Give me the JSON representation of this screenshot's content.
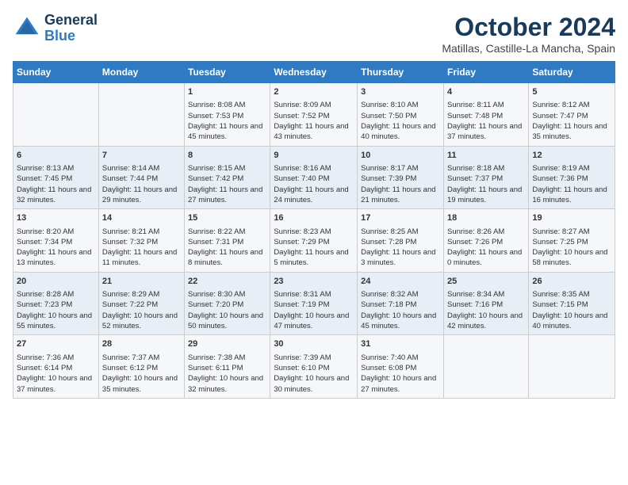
{
  "logo": {
    "line1": "General",
    "line2": "Blue"
  },
  "title": "October 2024",
  "location": "Matillas, Castille-La Mancha, Spain",
  "days_of_week": [
    "Sunday",
    "Monday",
    "Tuesday",
    "Wednesday",
    "Thursday",
    "Friday",
    "Saturday"
  ],
  "weeks": [
    [
      {
        "day": "",
        "content": ""
      },
      {
        "day": "",
        "content": ""
      },
      {
        "day": "1",
        "content": "Sunrise: 8:08 AM\nSunset: 7:53 PM\nDaylight: 11 hours and 45 minutes."
      },
      {
        "day": "2",
        "content": "Sunrise: 8:09 AM\nSunset: 7:52 PM\nDaylight: 11 hours and 43 minutes."
      },
      {
        "day": "3",
        "content": "Sunrise: 8:10 AM\nSunset: 7:50 PM\nDaylight: 11 hours and 40 minutes."
      },
      {
        "day": "4",
        "content": "Sunrise: 8:11 AM\nSunset: 7:48 PM\nDaylight: 11 hours and 37 minutes."
      },
      {
        "day": "5",
        "content": "Sunrise: 8:12 AM\nSunset: 7:47 PM\nDaylight: 11 hours and 35 minutes."
      }
    ],
    [
      {
        "day": "6",
        "content": "Sunrise: 8:13 AM\nSunset: 7:45 PM\nDaylight: 11 hours and 32 minutes."
      },
      {
        "day": "7",
        "content": "Sunrise: 8:14 AM\nSunset: 7:44 PM\nDaylight: 11 hours and 29 minutes."
      },
      {
        "day": "8",
        "content": "Sunrise: 8:15 AM\nSunset: 7:42 PM\nDaylight: 11 hours and 27 minutes."
      },
      {
        "day": "9",
        "content": "Sunrise: 8:16 AM\nSunset: 7:40 PM\nDaylight: 11 hours and 24 minutes."
      },
      {
        "day": "10",
        "content": "Sunrise: 8:17 AM\nSunset: 7:39 PM\nDaylight: 11 hours and 21 minutes."
      },
      {
        "day": "11",
        "content": "Sunrise: 8:18 AM\nSunset: 7:37 PM\nDaylight: 11 hours and 19 minutes."
      },
      {
        "day": "12",
        "content": "Sunrise: 8:19 AM\nSunset: 7:36 PM\nDaylight: 11 hours and 16 minutes."
      }
    ],
    [
      {
        "day": "13",
        "content": "Sunrise: 8:20 AM\nSunset: 7:34 PM\nDaylight: 11 hours and 13 minutes."
      },
      {
        "day": "14",
        "content": "Sunrise: 8:21 AM\nSunset: 7:32 PM\nDaylight: 11 hours and 11 minutes."
      },
      {
        "day": "15",
        "content": "Sunrise: 8:22 AM\nSunset: 7:31 PM\nDaylight: 11 hours and 8 minutes."
      },
      {
        "day": "16",
        "content": "Sunrise: 8:23 AM\nSunset: 7:29 PM\nDaylight: 11 hours and 5 minutes."
      },
      {
        "day": "17",
        "content": "Sunrise: 8:25 AM\nSunset: 7:28 PM\nDaylight: 11 hours and 3 minutes."
      },
      {
        "day": "18",
        "content": "Sunrise: 8:26 AM\nSunset: 7:26 PM\nDaylight: 11 hours and 0 minutes."
      },
      {
        "day": "19",
        "content": "Sunrise: 8:27 AM\nSunset: 7:25 PM\nDaylight: 10 hours and 58 minutes."
      }
    ],
    [
      {
        "day": "20",
        "content": "Sunrise: 8:28 AM\nSunset: 7:23 PM\nDaylight: 10 hours and 55 minutes."
      },
      {
        "day": "21",
        "content": "Sunrise: 8:29 AM\nSunset: 7:22 PM\nDaylight: 10 hours and 52 minutes."
      },
      {
        "day": "22",
        "content": "Sunrise: 8:30 AM\nSunset: 7:20 PM\nDaylight: 10 hours and 50 minutes."
      },
      {
        "day": "23",
        "content": "Sunrise: 8:31 AM\nSunset: 7:19 PM\nDaylight: 10 hours and 47 minutes."
      },
      {
        "day": "24",
        "content": "Sunrise: 8:32 AM\nSunset: 7:18 PM\nDaylight: 10 hours and 45 minutes."
      },
      {
        "day": "25",
        "content": "Sunrise: 8:34 AM\nSunset: 7:16 PM\nDaylight: 10 hours and 42 minutes."
      },
      {
        "day": "26",
        "content": "Sunrise: 8:35 AM\nSunset: 7:15 PM\nDaylight: 10 hours and 40 minutes."
      }
    ],
    [
      {
        "day": "27",
        "content": "Sunrise: 7:36 AM\nSunset: 6:14 PM\nDaylight: 10 hours and 37 minutes."
      },
      {
        "day": "28",
        "content": "Sunrise: 7:37 AM\nSunset: 6:12 PM\nDaylight: 10 hours and 35 minutes."
      },
      {
        "day": "29",
        "content": "Sunrise: 7:38 AM\nSunset: 6:11 PM\nDaylight: 10 hours and 32 minutes."
      },
      {
        "day": "30",
        "content": "Sunrise: 7:39 AM\nSunset: 6:10 PM\nDaylight: 10 hours and 30 minutes."
      },
      {
        "day": "31",
        "content": "Sunrise: 7:40 AM\nSunset: 6:08 PM\nDaylight: 10 hours and 27 minutes."
      },
      {
        "day": "",
        "content": ""
      },
      {
        "day": "",
        "content": ""
      }
    ]
  ]
}
